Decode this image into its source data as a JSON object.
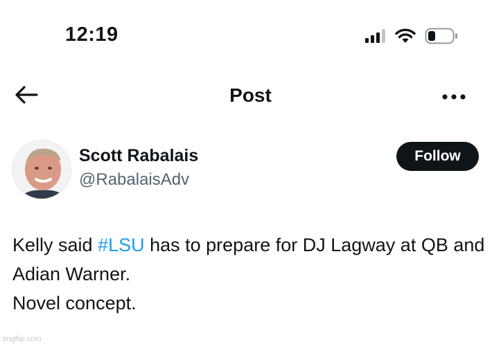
{
  "status_bar": {
    "time": "12:19",
    "icons": [
      "cellular-signal-icon",
      "wifi-icon",
      "battery-icon"
    ]
  },
  "nav": {
    "title": "Post",
    "back_icon": "arrow-left-icon",
    "more_icon": "more-horizontal-icon"
  },
  "author": {
    "name": "Scott Rabalais",
    "handle": "@RabalaisAdv",
    "follow_label": "Follow"
  },
  "tweet": {
    "part1": "Kelly said ",
    "hashtag": "#LSU",
    "part2": " has to prepare for DJ Lagway at QB and Adian Warner.",
    "line3": "Novel concept."
  },
  "watermark": "imgflip.com",
  "colors": {
    "text": "#0f1419",
    "secondary": "#536471",
    "link": "#1d9bf0",
    "button_bg": "#0f1419",
    "button_text": "#ffffff",
    "background": "#ffffff"
  }
}
